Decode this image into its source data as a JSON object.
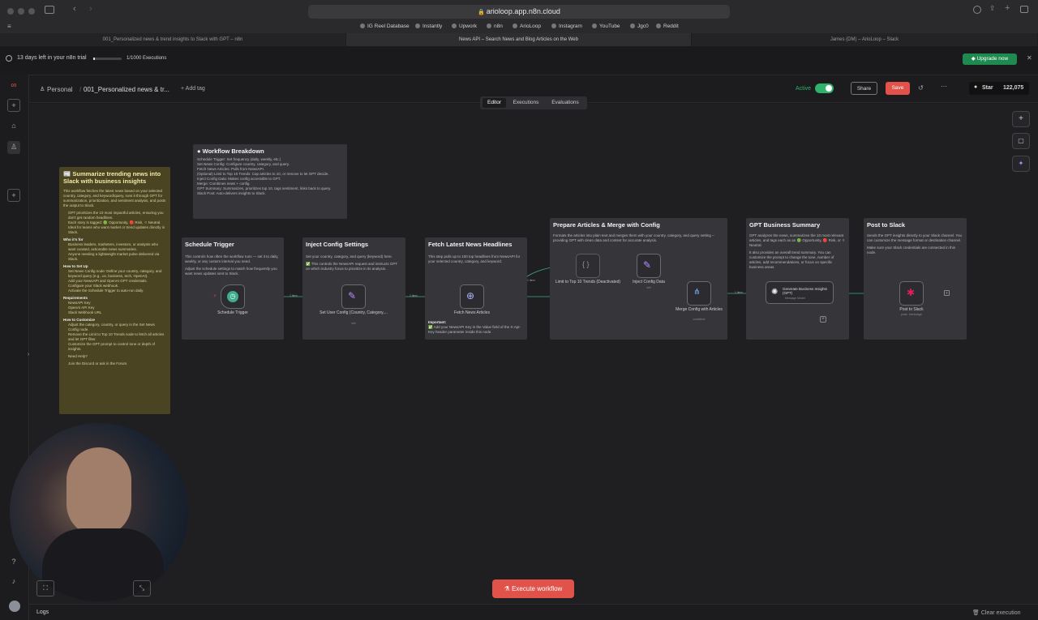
{
  "browser": {
    "url": "arioloop.app.n8n.cloud",
    "bookmarks": [
      "IG Reel Database",
      "Instantly",
      "Upwork",
      "n8n",
      "ArioLoop",
      "Instagram",
      "YouTube",
      "Jgc0",
      "Reddit"
    ],
    "tabs": [
      "001_Personalized news & trend insights to Slack with GPT – n8n",
      "News API – Search News and Blog Articles on the Web",
      "James (DM) – ArioLoop – Slack"
    ]
  },
  "trial": {
    "days_left": "13 days left in your n8n trial",
    "executions": "1/1000 Executions",
    "executions_used": 1,
    "executions_total": 1000,
    "upgrade_label": "Upgrade now"
  },
  "header": {
    "breadcrumb_owner": "Personal",
    "workflow_name": "001_Personalized news & tr...",
    "add_tag": "+ Add tag",
    "active_label": "Active",
    "share_label": "Share",
    "save_label": "Save",
    "star_label": "Star",
    "star_count": "122,075"
  },
  "mode_tabs": [
    "Editor",
    "Executions",
    "Evaluations"
  ],
  "stickies": {
    "summary": {
      "title": "📰 Summarize trending news into Slack with business insights",
      "body": "This workflow fetches the latest news based on your selected country, category, and keyword/query, runs it through GPT for summarization, prioritization, and sentiment analysis, and posts the output to Slack.",
      "bullets": [
        "GPT prioritizes the 10 most impactful articles, ensuring you don't get random headlines.",
        "Each story is tagged: 🟢 Opportunity, 🔴 Risk, ⚪ Neutral.",
        "Ideal for teams who want market or trend updates directly in Slack."
      ],
      "who_title": "Who it's for",
      "who": [
        "Business leaders, marketers, investors, or analysts who want curated, actionable news summaries.",
        "Anyone needing a lightweight market pulse delivered via Slack."
      ],
      "setup_title": "How to Set Up",
      "setup": [
        "Set News Config node: Define your country, category, and keyword query (e.g., us, business, tech, OpenAI).",
        "Add your NewsAPI and OpenAI GPT credentials.",
        "Configure your Slack webhook.",
        "Activate the Schedule Trigger to auto-run daily."
      ],
      "req_title": "Requirements",
      "req": [
        "NewsAPI Key",
        "OpenAI API Key",
        "Slack Webhook URL"
      ],
      "custom_title": "How to Customize",
      "custom": [
        "Adjust the category, country, or query in the Set News Config node.",
        "Remove the Limit to Top 10 Trends node to fetch all articles and let GPT filter.",
        "Customize the GPT prompt to control tone or depth of insights."
      ],
      "help": "Need Help?",
      "join": "Join the Discord or ask in the Forum."
    },
    "breakdown": {
      "title": "Workflow Breakdown",
      "items": [
        "Schedule Trigger: Set frequency (daily, weekly, etc.)",
        "Set News Config: Configure country, category, and query.",
        "Fetch News Articles: Pulls from NewsAPI.",
        "(Optional) Limit to Top 10 Trends: Cap articles to 10, or remove to let GPT decide.",
        "Inject Config Data: Makes config accessible to GPT.",
        "Merge: Combines news + config.",
        "GPT Summary: Summarizes, prioritizes top 10, tags sentiment, links back to query.",
        "Slack Post: Auto-delivers insights to Slack."
      ]
    },
    "schedule": {
      "title": "Schedule Trigger",
      "body": "This controls how often the workflow runs — set it to daily, weekly, or any custom interval you need.",
      "body2": "Adjust the schedule settings to match how frequently you want news updates sent to Slack."
    },
    "inject": {
      "title": "Inject Config Settings",
      "body": "Set your country, category, and query (keyword) here.",
      "body2": "✅ This controls the NewsAPI request and instructs GPT on which industry focus to prioritize in its analysis."
    },
    "fetch": {
      "title": "Fetch Latest News Headlines",
      "body": "This step pulls up to 100 top headlines from NewsAPI for your selected country, category, and keyword.",
      "important": "Important:",
      "important_body": "✅ Add your NewsAPI Key in the Value field of the X-Api-Key header parameter inside this node."
    },
    "prepare": {
      "title": "Prepare Articles & Merge with Config",
      "body": "Formats the articles into plain text and merges them with your country, category, and query setting – providing GPT with clean data and context for accurate analysis."
    },
    "gpt": {
      "title": "GPT Business Summary",
      "body": "GPT analyzes the news, summarizes the 10 most relevant articles, and tags each as an 🟢 Opportunity, 🔴 Risk, or ⚪ Neutral.",
      "body2": "It also provides an overall trend summary. You can customize the prompt to change the tone, number of articles, add recommendations, or focus on specific business areas."
    },
    "slack": {
      "title": "Post to Slack",
      "body": "Sends the GPT insights directly to your Slack channel. You can customize the message format or destination channel.",
      "body2": "Make sure your Slack credentials are connected in this node."
    }
  },
  "nodes": {
    "schedule": {
      "label": "Schedule Trigger"
    },
    "set_config": {
      "label": "Set User Config (Country, Category,...",
      "sub": "set"
    },
    "fetch": {
      "label": "Fetch News Articles"
    },
    "limit": {
      "label": "Limit to Top 10 Trends (Deactivated)"
    },
    "inject": {
      "label": "Inject Config Data",
      "sub": "set"
    },
    "merge": {
      "label": "Merge Config with Articles",
      "sub": "combine"
    },
    "gpt": {
      "label": "Generate Business Insights (GPT)",
      "sub": "Message Model"
    },
    "slack": {
      "label": "Post to Slack",
      "sub": "post: message"
    }
  },
  "edges": {
    "item1": "1 item",
    "item2": "1 item",
    "item3": "1 item",
    "item4": "1 item",
    "item5": "1 item",
    "item6": "1 item",
    "item7": "1 item"
  },
  "execute_label": "Execute workflow",
  "bottom": {
    "logs": "Logs",
    "clear": "Clear execution"
  },
  "colors": {
    "accent": "#e0524a",
    "active": "#2fb36b",
    "upgrade": "#1e8a4f",
    "edge": "#3fae8a",
    "sticky_yellow": "#4a4422"
  }
}
